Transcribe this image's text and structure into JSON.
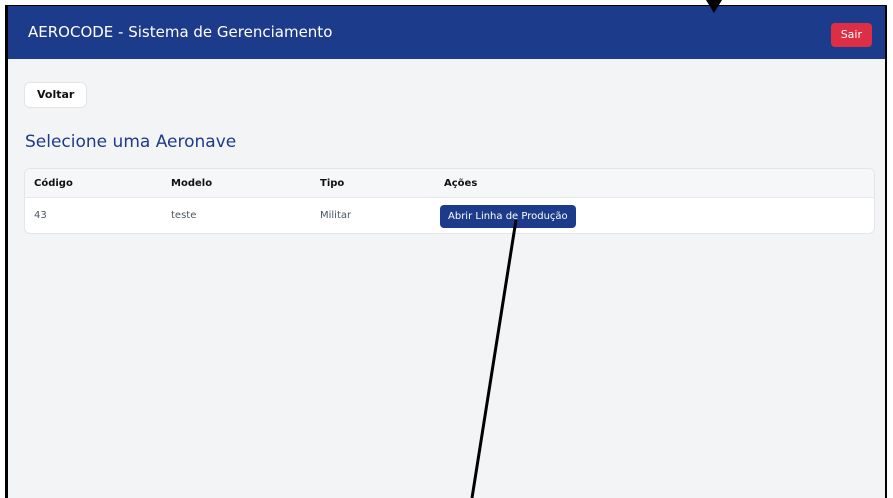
{
  "header": {
    "title": "AEROCODE - Sistema de Gerenciamento",
    "logout_label": "Sair"
  },
  "toolbar": {
    "back_label": "Voltar"
  },
  "main": {
    "title": "Selecione uma Aeronave"
  },
  "table": {
    "headers": [
      "Código",
      "Modelo",
      "Tipo",
      "Ações"
    ],
    "rows": [
      {
        "codigo": "43",
        "modelo": "teste",
        "tipo": "Militar",
        "action_label": "Abrir Linha de Produção"
      }
    ]
  },
  "colors": {
    "primary": "#1d3b8b",
    "danger": "#dc2f45",
    "background": "#f3f4f6"
  }
}
